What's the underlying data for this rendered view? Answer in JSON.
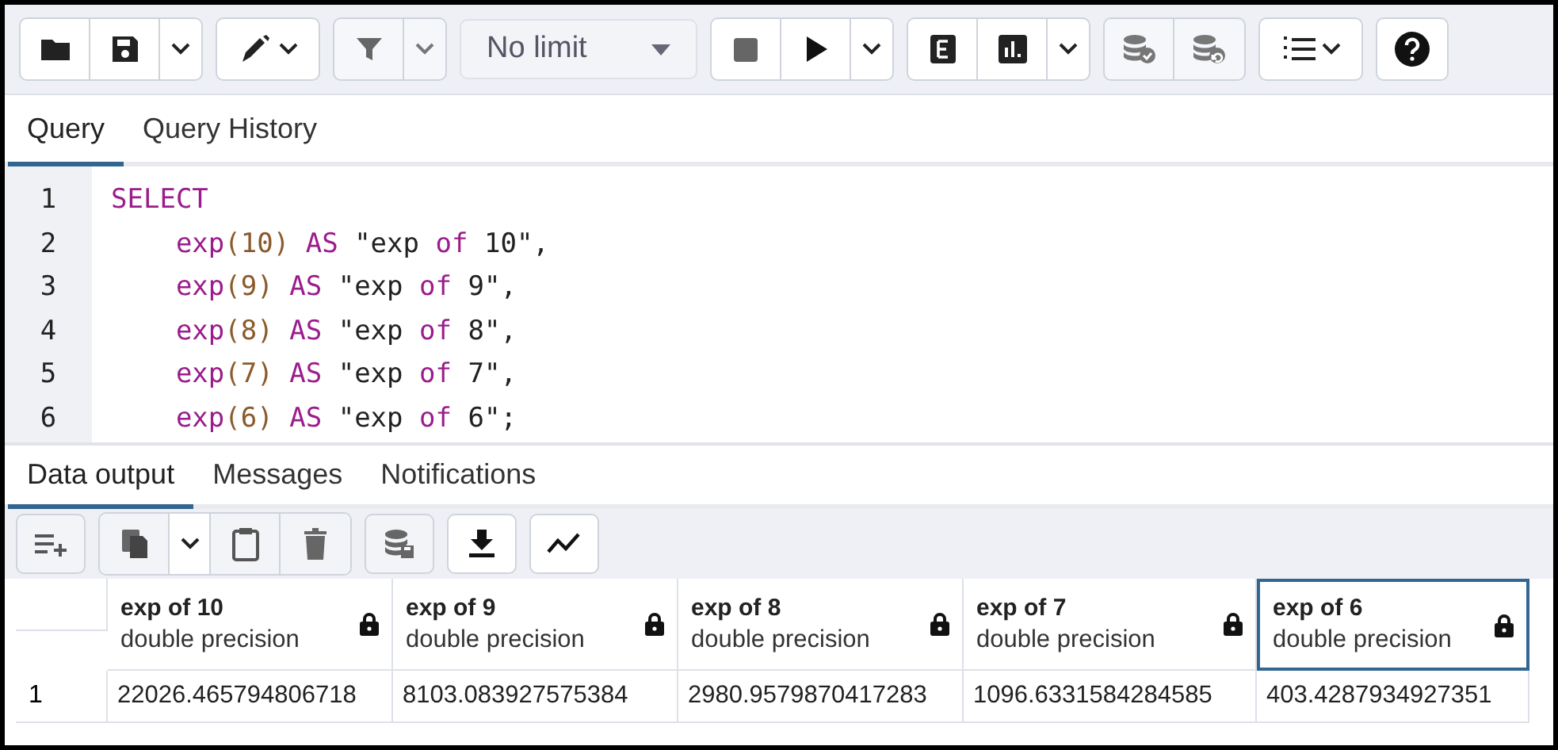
{
  "toolbar": {
    "row_limit": "No limit"
  },
  "editor_tabs": [
    {
      "label": "Query",
      "selected": true
    },
    {
      "label": "Query History",
      "selected": false
    }
  ],
  "editor": {
    "lines": [
      {
        "number": "1",
        "indented": false,
        "tokens": [
          {
            "text": "SELECT",
            "kind": "keyword"
          }
        ]
      },
      {
        "number": "2",
        "indented": true,
        "tokens": [
          {
            "text": "exp",
            "kind": "keyword"
          },
          {
            "text": "(10) ",
            "kind": "number"
          },
          {
            "text": "AS",
            "kind": "keyword"
          },
          {
            "text": " \"exp ",
            "kind": "plain"
          },
          {
            "text": "of",
            "kind": "keyword"
          },
          {
            "text": " 10\",",
            "kind": "plain"
          }
        ]
      },
      {
        "number": "3",
        "indented": true,
        "tokens": [
          {
            "text": "exp",
            "kind": "keyword"
          },
          {
            "text": "(9) ",
            "kind": "number"
          },
          {
            "text": "AS",
            "kind": "keyword"
          },
          {
            "text": " \"exp ",
            "kind": "plain"
          },
          {
            "text": "of",
            "kind": "keyword"
          },
          {
            "text": " 9\",",
            "kind": "plain"
          }
        ]
      },
      {
        "number": "4",
        "indented": true,
        "tokens": [
          {
            "text": "exp",
            "kind": "keyword"
          },
          {
            "text": "(8) ",
            "kind": "number"
          },
          {
            "text": "AS",
            "kind": "keyword"
          },
          {
            "text": " \"exp ",
            "kind": "plain"
          },
          {
            "text": "of",
            "kind": "keyword"
          },
          {
            "text": " 8\",",
            "kind": "plain"
          }
        ]
      },
      {
        "number": "5",
        "indented": true,
        "tokens": [
          {
            "text": "exp",
            "kind": "keyword"
          },
          {
            "text": "(7) ",
            "kind": "number"
          },
          {
            "text": "AS",
            "kind": "keyword"
          },
          {
            "text": " \"exp ",
            "kind": "plain"
          },
          {
            "text": "of",
            "kind": "keyword"
          },
          {
            "text": " 7\",",
            "kind": "plain"
          }
        ]
      },
      {
        "number": "6",
        "indented": true,
        "tokens": [
          {
            "text": "exp",
            "kind": "keyword"
          },
          {
            "text": "(6) ",
            "kind": "number"
          },
          {
            "text": "AS",
            "kind": "keyword"
          },
          {
            "text": " \"exp ",
            "kind": "plain"
          },
          {
            "text": "of",
            "kind": "keyword"
          },
          {
            "text": " 6\";",
            "kind": "plain"
          }
        ]
      }
    ]
  },
  "output_tabs": [
    {
      "label": "Data output",
      "selected": true
    },
    {
      "label": "Messages",
      "selected": false
    },
    {
      "label": "Notifications",
      "selected": false
    }
  ],
  "table": {
    "columns": [
      {
        "name": "exp of 10",
        "type": "double precision",
        "selected": false
      },
      {
        "name": "exp of 9",
        "type": "double precision",
        "selected": false
      },
      {
        "name": "exp of 8",
        "type": "double precision",
        "selected": false
      },
      {
        "name": "exp of 7",
        "type": "double precision",
        "selected": false
      },
      {
        "name": "exp of 6",
        "type": "double precision",
        "selected": true
      }
    ],
    "rows": [
      {
        "number": "1",
        "cells": [
          "22026.465794806718",
          "8103.083927575384",
          "2980.9579870417283",
          "1096.6331584284585",
          "403.4287934927351"
        ]
      }
    ]
  }
}
